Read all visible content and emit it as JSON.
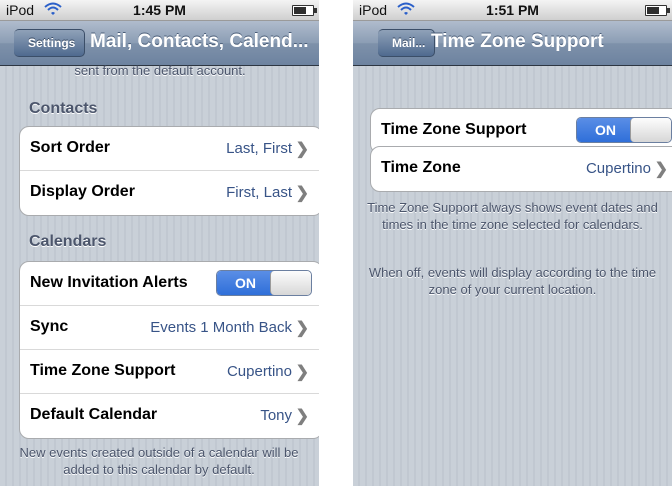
{
  "left": {
    "status": {
      "carrier": "iPod",
      "time": "1:45 PM"
    },
    "nav": {
      "back": "Settings",
      "title": "Mail, Contacts, Calend..."
    },
    "top_partial_text": "sent from the default account.",
    "contacts_header": "Contacts",
    "contacts": [
      {
        "label": "Sort Order",
        "value": "Last, First"
      },
      {
        "label": "Display Order",
        "value": "First, Last"
      }
    ],
    "calendars_header": "Calendars",
    "calendars": {
      "invitation_alerts": {
        "label": "New Invitation Alerts",
        "toggle": "ON"
      },
      "sync": {
        "label": "Sync",
        "value": "Events 1 Month Back"
      },
      "time_zone_support": {
        "label": "Time Zone Support",
        "value": "Cupertino"
      },
      "default_calendar": {
        "label": "Default Calendar",
        "value": "Tony"
      }
    },
    "footnote": "New events created outside of a calendar will be added to this calendar by default."
  },
  "right": {
    "status": {
      "carrier": "iPod",
      "time": "1:51 PM"
    },
    "nav": {
      "back": "Mail...",
      "title": "Time Zone Support"
    },
    "tz_support": {
      "label": "Time Zone Support",
      "toggle": "ON"
    },
    "tz": {
      "label": "Time Zone",
      "value": "Cupertino"
    },
    "note1": "Time Zone Support always shows event dates and times in the time zone selected for calendars.",
    "note2": "When off, events will display according to the time zone of your current location."
  },
  "colors": {
    "value_blue": "#385487",
    "toggle_blue": "#2f6fd9",
    "nav_blue": "#6d83a0"
  },
  "icons": [
    "wifi-icon",
    "battery-icon",
    "chevron-right-icon"
  ]
}
